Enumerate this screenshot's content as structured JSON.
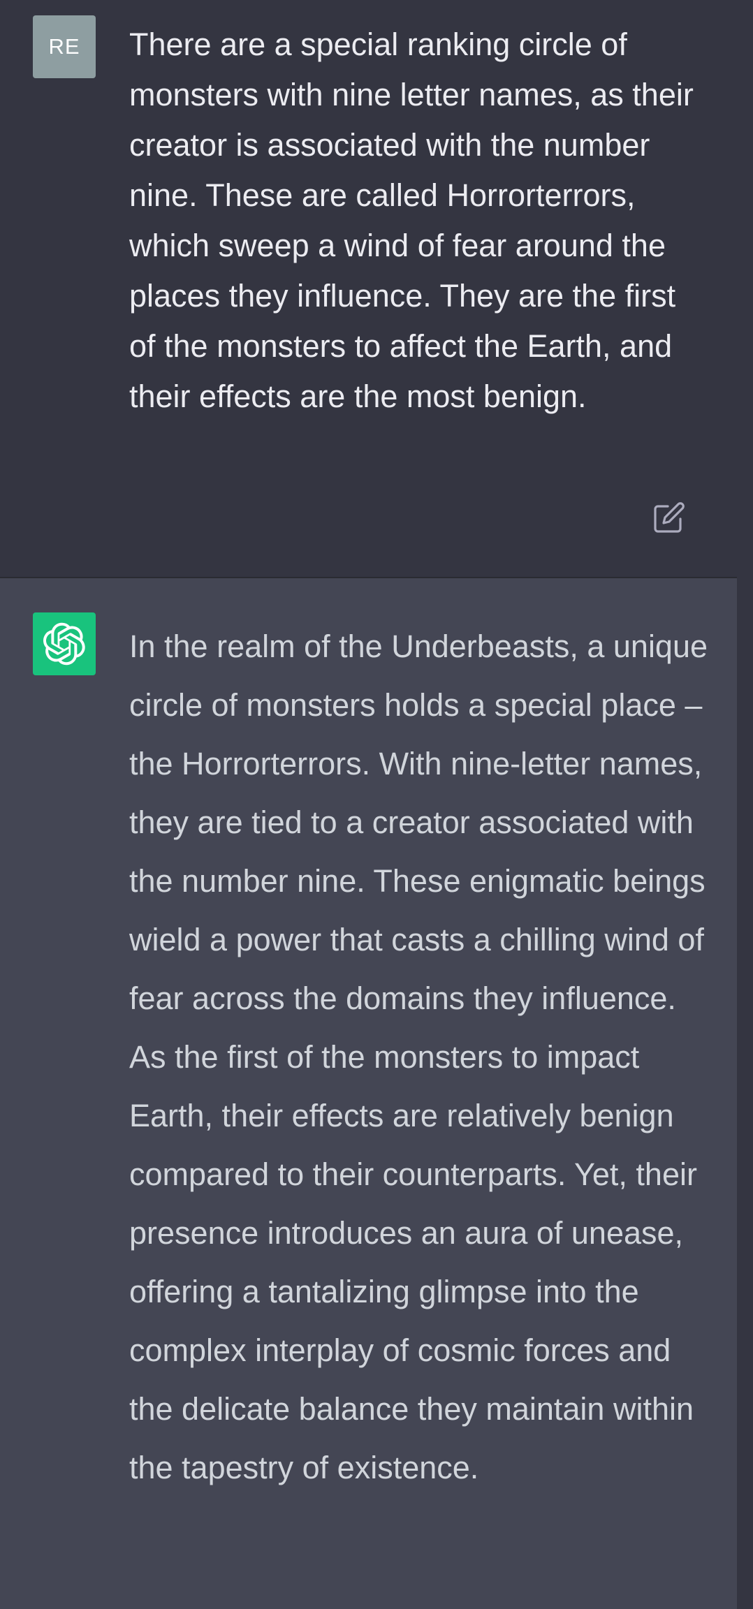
{
  "user_message": {
    "avatar_initials": "RE",
    "avatar_color": "#8e9ea1",
    "text": "There are a special ranking circle of monsters with nine letter names, as their creator is associated with the number nine. These are called Horrorterrors, which sweep a wind of fear around the places they influence. They are the first of the monsters to affect the Earth, and their effects are the most benign.",
    "action_icon": "edit-icon"
  },
  "assistant_message": {
    "avatar_icon": "openai-logo-icon",
    "avatar_color": "#19c37d",
    "text": "In the realm of the Underbeasts, a unique circle of monsters holds a special place – the Horrorterrors. With nine-letter names, they are tied to a creator associated with the number nine. These enigmatic beings wield a power that casts a chilling wind of fear across the domains they influence. As the first of the monsters to impact Earth, their effects are relatively benign compared to their counterparts. Yet, their presence introduces an aura of unease, offering a tantalizing glimpse into the complex interplay of cosmic forces and the delicate balance they maintain within the tapestry of existence."
  },
  "colors": {
    "user_background": "#343541",
    "assistant_background": "#444654",
    "user_text": "#ececf1",
    "assistant_text": "#d1d5db"
  }
}
